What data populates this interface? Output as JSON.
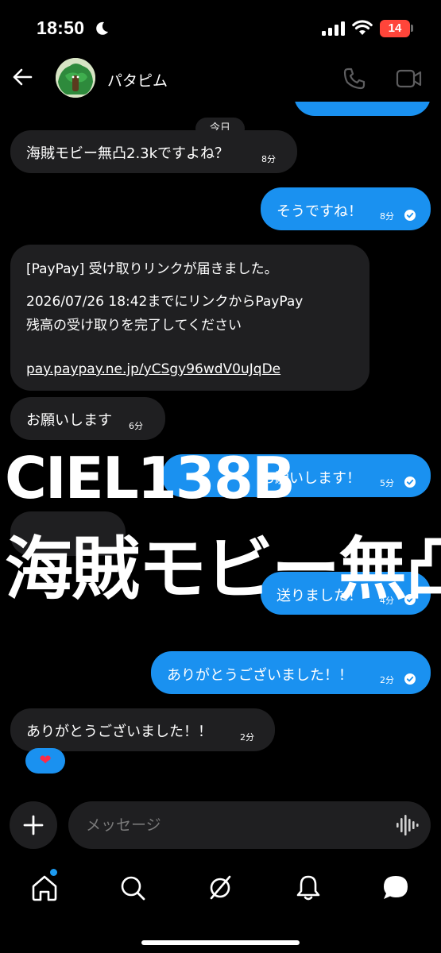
{
  "status_bar": {
    "time": "18:50",
    "battery": "14"
  },
  "header": {
    "contact_name": "パタピム"
  },
  "chat": {
    "date_label": "今日",
    "messages": [
      {
        "text": "海賊モビー無凸2.3kですよね？",
        "time": "8分"
      },
      {
        "text": "そうですね！",
        "time": "8分"
      },
      {
        "line1": "[PayPay] 受け取りリンクが届きました。",
        "line2": "2026/07/26 18:42までにリンクからPayPay",
        "line3": "残高の受け取りを完了してください",
        "link": "pay.paypay.ne.jp/yCSgy96wdV0uJqDe"
      },
      {
        "text": "お願いします",
        "time": "6分"
      },
      {
        "text": "お願いします！",
        "time": "5分"
      },
      {
        "text": "送りました！",
        "time": "4分"
      },
      {
        "text": "ありがとうございました！！",
        "time": "2分"
      },
      {
        "text": "ありがとうございました！！",
        "time": "2分",
        "reaction": "❤"
      }
    ]
  },
  "overlay": {
    "line1": "CIEL138B",
    "line2": "海賊モビー無凸"
  },
  "composer": {
    "placeholder": "メッセージ"
  },
  "colors": {
    "incoming_bubble": "#1f1f21",
    "outgoing_bubble": "#1a91f0",
    "accent": "#1d9bf0",
    "battery_low": "#ff453a"
  }
}
